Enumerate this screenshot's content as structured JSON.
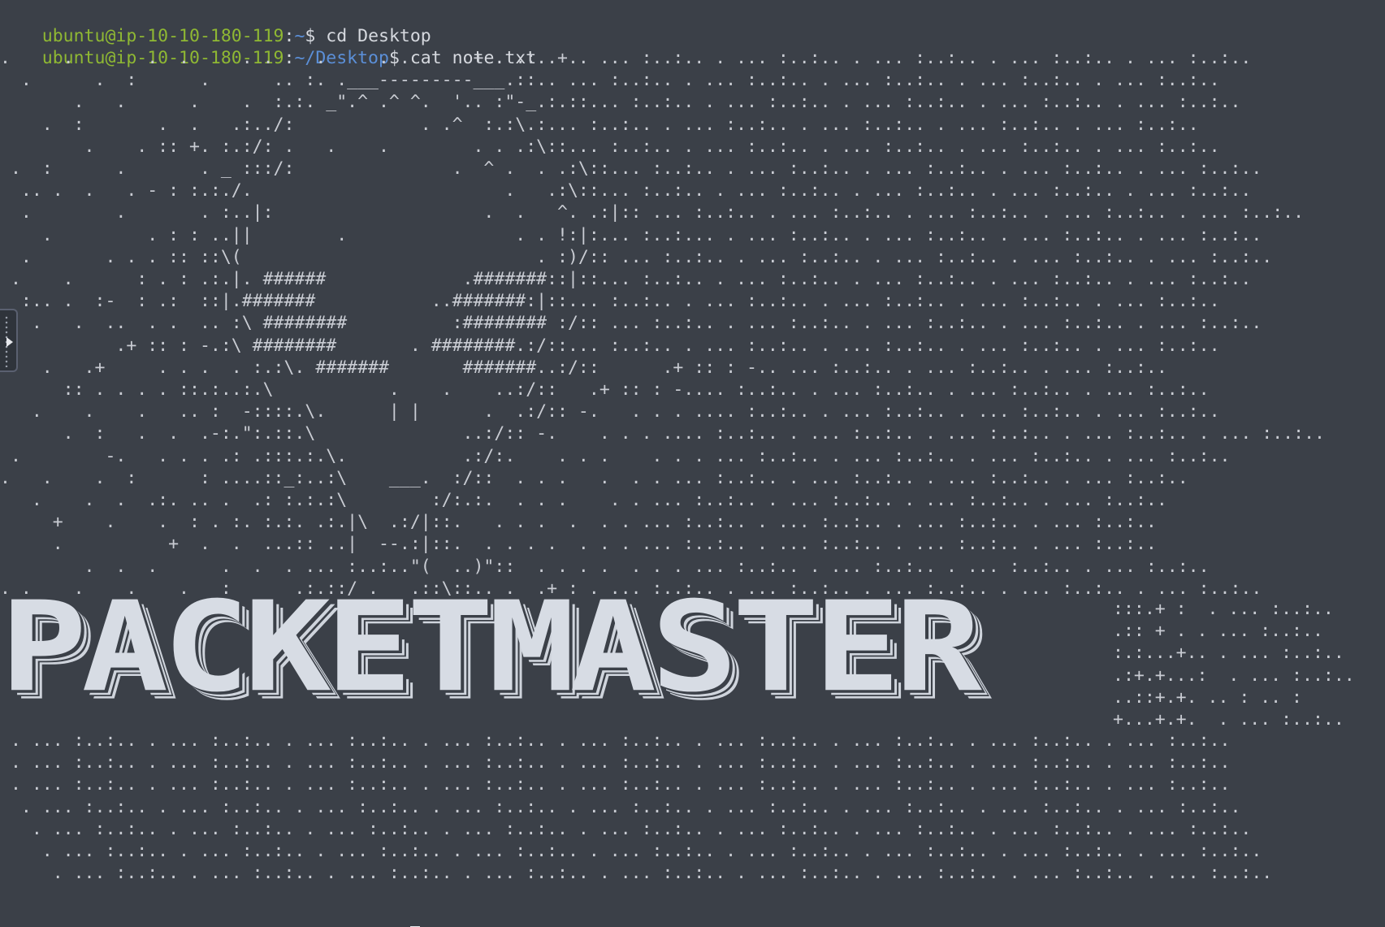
{
  "prompt": {
    "user_host": "ubuntu@ip-10-10-180-119",
    "colon": ":",
    "home_path": "~",
    "desktop_path": "~/Desktop",
    "dollar": "$"
  },
  "commands": {
    "first": " cd Desktop",
    "second": " cat note.txt"
  },
  "art_lines": [
    ".     .       .  .     . .    .     . .      +   .:..+.. ... :..:.. . ... :..:.. . ... :..:.. . ... :..:.. . ... :..:..",
    "  .      .  :      .      .. :. .___---------___.::.. ... :..:.. . ... :..:.. . ... :..:.. . ... :..:.. . ... :..:..",
    "       .   .      .    .  :.:. _\".^ .^ ^.  '.. :\"-_.:.::... :..:.. . ... :..:.. . ... :..:.. . ... :..:.. . ... :..:..",
    "    .  :       .  .   .:../:            . .^  :.:\\.:... :..:.. . ... :..:.. . ... :..:.. . ... :..:.. . ... :..:..",
    "        .    . :: +. :.:/: .   .    .        . . .:\\::... :..:.. . ... :..:.. . ... :..:.. . ... :..:.. . ... :..:..",
    " .  :      .       . _ :::/:               .  ^ .  . .:\\::... :..:.. . ... :..:.. . ... :..:.. . ... :..:.. . ... :..:..",
    "  .. .  .   . - : :.:./.                        .   .:\\::... :..:.. . ... :..:.. . ... :..:.. . ... :..:.. . ... :..:..",
    "  .        .       . :..|:                    .  .   ^. .:|:: ... :..:.. . ... :..:.. . ... :..:.. . ... :..:.. . ... :..:..",
    "    .         . : : ..||        .                . . !:|:... :..:... . ... :..:.. . ... :..:.. . ... :..:.. . ... :..:..",
    "  .       . . . :: ::\\(                            . :)/:: ... :..:.. . ... :..:.. . ... :..:.. . ... :..:.. . ... :..:..",
    " .    .      : . : .:.|. ######             .#######::|::... :..:.. . ... :..:.. . ... :..:.. . ... :..:.. . ... :..:..",
    "  :.. .  :-  : .:  ::|.#######           ..#######:|::... :..:.. . ... :..:.. . ... :..:.. . ... :..:.. . ... :..:..",
    "   .   .  ..  . .  .. :\\ ########          :######## :/:: ... :..:.. . ... :..:.. . ... :..:.. . ... :..:.. . ... :..:..",
    "           .+ :: : -.:\\ ########       . ########.:/::... :..:.. . ... :..:.. . ... :..:.. . ... :..:.. . ... :..:..",
    "    .   .+     . . .  . :.:\\. #######       #######..:/::      .+ :: : -.. ... :..:.. . ... :..:.. . ... :..:..",
    "      :: . . . . ::.:..:.\\           .    .    ..:/::   .+ :: : -.... :..:.. . ... :..:.. . ... :..:.. . ... :..:..",
    "   .    .    .   .. :  -::::.\\.      | |      .  .:/:: -.   . . . .... :..:.. . ... :..:.. . ... :..:.. . ... :..:..",
    "      .  :   .  .  .-:.\":.::.\\              ..:/:: -.    . . . .... :..:.. . ... :..:.. . ... :..:.. . ... :..:.. . ... :..:..",
    " .        -.   . . . .: .:::.:.\\.           .:/:.    . . .    . . . ... :..:.. . ... :..:.. . ... :..:.. . ... :..:..",
    ".   .    .  :      : ....::_:..:\\    ___.  :/::  . . .   .  . . ... :..:.. . ... :..:.. . ... :..:.. . ... :..:..",
    "   .    .  .  .:. .. .  .: :.:.:\\        :/:.:.  . . .    . . ... :..:.. . ... :..:.. . ... :..:.. . ... :..:..",
    "     +    .    .  : . :. :.:. .:.|\\  .:/|::.   . . .  .  . . ... :..:.. . ... :..:.. . ... :..:.. . ... :..:..",
    "     .          +  .  .  ...:: ..|  --.:|::.  . . . .  . . . ... :..:.. . ... :..:.. . ... :..:.. . ... :..:..",
    "        .  .  .      .  .  . ... :..:..\"(  ..)\"::  . . . .  . . . ... :..:.. . ... :..:.. . ... :..:.. . ... :..:..",
    ". .    .    .    .   :      .:.::/ .   .::\\::.. .  .+ : . ... :..:.. . ... :..:.. . ... :..:.. . ... :..:.. . ... :..:.."
  ],
  "banner": {
    "text": "PACKETMASTER",
    "side_lines": [
      ":::.+ :  . ... :..:..",
      ".:: + . . ... :..:..",
      ":.:...+.. . ... :..:..",
      ".:+.+...:  . ... :..:..",
      "..::+.+. .. : .. :",
      "+...+.+.  . ... :..:.."
    ]
  },
  "bottom_lines": [
    " . ... :..:.. . ... :..:.. . ... :..:.. . ... :..:.. . ... :..:.. . ... :..:.. . ... :..:.. . ... :..:.. . ... :..:..",
    " . ... :..:.. . ... :..:.. . ... :..:.. . ... :..:.. . ... :..:.. . ... :..:.. . ... :..:.. . ... :..:.. . ... :..:..",
    " . ... :..:.. . ... :..:.. . ... :..:.. . ... :..:.. . ... :..:.. . ... :..:.. . ... :..:.. . ... :..:.. . ... :..:..",
    "  . ... :..:.. . ... :..:.. . ... :..:.. . ... :..:.. . ... :..:.. . ... :..:.. . ... :..:.. . ... :..:.. . ... :..:..",
    "   . ... :..:.. . ... :..:.. . ... :..:.. . ... :..:.. . ... :..:.. . ... :..:.. . ... :..:.. . ... :..:.. . ... :..:..",
    "    . ... :..:.. . ... :..:.. . ... :..:.. . ... :..:.. . ... :..:.. . ... :..:.. . ... :..:.. . ... :..:.. . ... :..:..",
    "     . ... :..:.. . ... :..:.. . ... :..:.. . ... :..:.. . ... :..:.. . ... :..:.. . ... :..:.. . ... :..:.. . ... :..:.."
  ],
  "colors": {
    "background": "#3b4048",
    "user_host": "#8fb833",
    "path": "#5b8fd8",
    "text": "#d6d9df"
  },
  "icons": {
    "side_handle": "collapsed-panel-handle-icon"
  }
}
